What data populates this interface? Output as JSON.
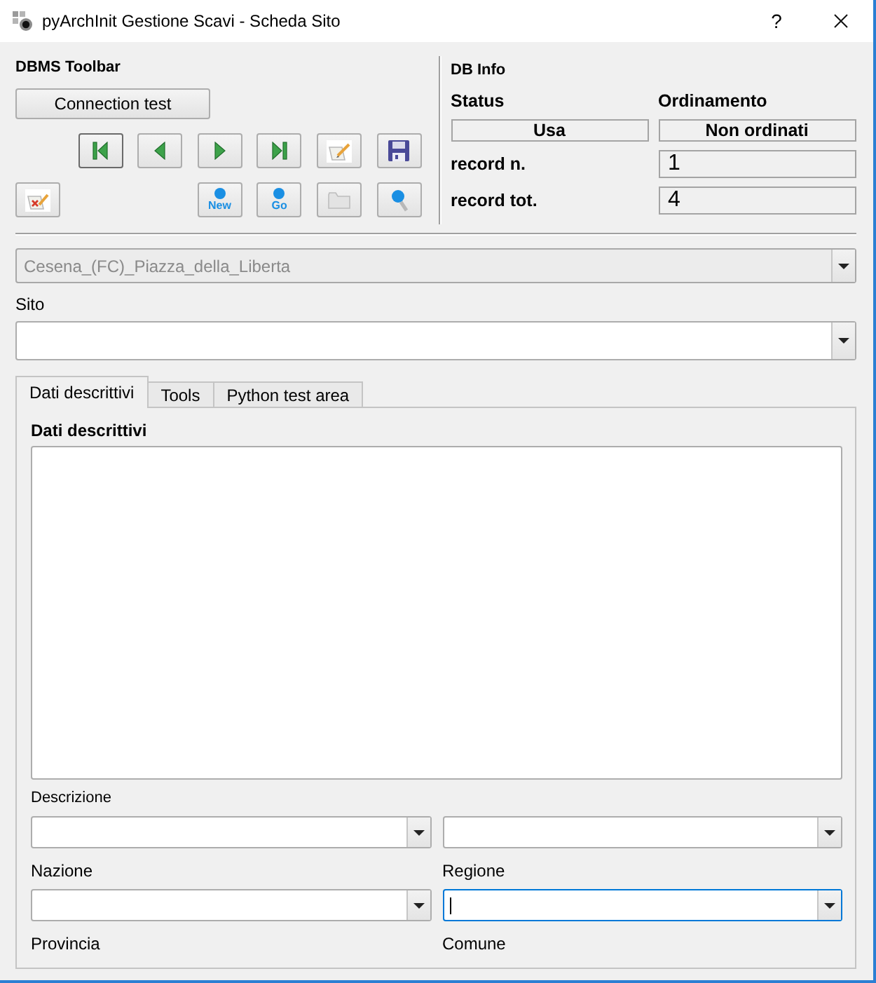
{
  "window": {
    "title": "pyArchInit Gestione Scavi - Scheda Sito",
    "help": "?"
  },
  "toolbar": {
    "title": "DBMS Toolbar",
    "connection_button": "Connection test",
    "rows": [
      {
        "right": [
          {
            "kind": "first",
            "focused": true
          },
          {
            "kind": "previous",
            "focused": false
          },
          {
            "kind": "next",
            "focused": false
          },
          {
            "kind": "last",
            "focused": false
          },
          {
            "kind": "edit",
            "focused": false
          },
          {
            "kind": "save",
            "focused": false
          }
        ]
      },
      {
        "left": [
          {
            "kind": "delete",
            "focused": false
          }
        ],
        "right": [
          {
            "kind": "new",
            "label": "New",
            "focused": false
          },
          {
            "kind": "go",
            "label": "Go",
            "focused": false
          },
          {
            "kind": "folder",
            "focused": false
          },
          {
            "kind": "search",
            "focused": false
          }
        ]
      }
    ]
  },
  "db_info": {
    "title": "DB Info",
    "status_label": "Status",
    "order_label": "Ordinamento",
    "status": "Usa",
    "order": "Non ordinati",
    "record_n_label": "record n.",
    "record_n": "1",
    "record_tot_label": "record tot.",
    "record_tot": "4"
  },
  "site_combo": {
    "value": "Cesena_(FC)_Piazza_della_Liberta",
    "disabled": true
  },
  "sito": {
    "label": "Sito"
  },
  "tabs": [
    {
      "label": "Dati descrittivi",
      "selected": true
    },
    {
      "label": "Tools",
      "selected": false
    },
    {
      "label": "Python test area",
      "selected": false
    }
  ],
  "tab_panel": {
    "title": "Dati descrittivi",
    "form": [
      {
        "kind": "caption",
        "texts": [
          "Descrizione"
        ]
      },
      {
        "kind": "combos",
        "combos": [
          {
            "focused": false
          },
          {
            "focused": false
          }
        ]
      },
      {
        "kind": "labels",
        "texts": [
          "Nazione",
          "Regione"
        ]
      },
      {
        "kind": "combos",
        "combos": [
          {
            "focused": false
          },
          {
            "focused": true
          }
        ]
      },
      {
        "kind": "labels",
        "texts": [
          "Provincia",
          "Comune"
        ]
      }
    ]
  }
}
